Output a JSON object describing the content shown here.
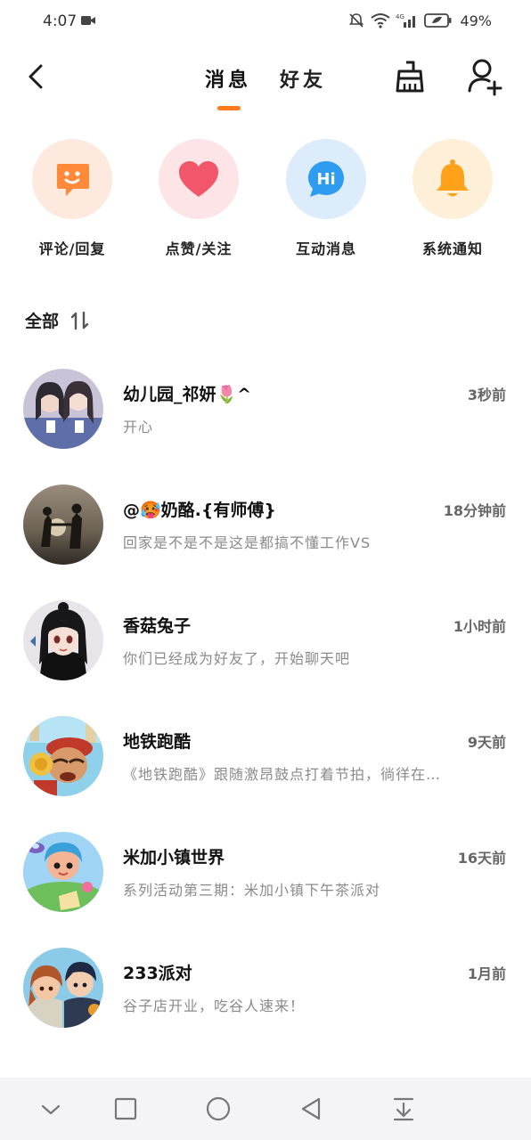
{
  "status_bar": {
    "time": "4:07",
    "network": "4G",
    "battery_percent": "49%"
  },
  "header": {
    "tabs": [
      {
        "label": "消息",
        "active": true
      },
      {
        "label": "好友",
        "active": false
      }
    ],
    "accent_color": "#ff7a1a"
  },
  "categories": [
    {
      "label": "评论/回复",
      "icon": "smile-chat-icon",
      "bg": "#fde9dd",
      "color": "#ff8a3a"
    },
    {
      "label": "点赞/关注",
      "icon": "heart-icon",
      "bg": "#fde4e6",
      "color": "#f2566a"
    },
    {
      "label": "互动消息",
      "icon": "hi-bubble-icon",
      "bg": "#dcecfb",
      "color": "#2e9cf0",
      "glyph": "Hi"
    },
    {
      "label": "系统通知",
      "icon": "bell-icon",
      "bg": "#fdefd8",
      "color": "#ffa21a"
    }
  ],
  "section": {
    "title": "全部",
    "sort_icon": "sort-icon"
  },
  "conversations": [
    {
      "name": "幼儿园_祁妍🌷^",
      "time": "3秒前",
      "preview": "开心"
    },
    {
      "name": "@🥵奶酪.{有师傅}",
      "time": "18分钟前",
      "preview": "回家是不是不是这是都搞不懂工作VS"
    },
    {
      "name": "香菇兔子",
      "time": "1小时前",
      "preview": "你们已经成为好友了，开始聊天吧"
    },
    {
      "name": "地铁跑酷",
      "time": "9天前",
      "preview": "《地铁跑酷》跟随激昂鼓点打着节拍，徜徉在…"
    },
    {
      "name": "米加小镇世界",
      "time": "16天前",
      "preview": "系列活动第三期：米加小镇下午茶派对"
    },
    {
      "name": "233派对",
      "time": "1月前",
      "preview": "谷子店开业，吃谷人速来！"
    }
  ]
}
